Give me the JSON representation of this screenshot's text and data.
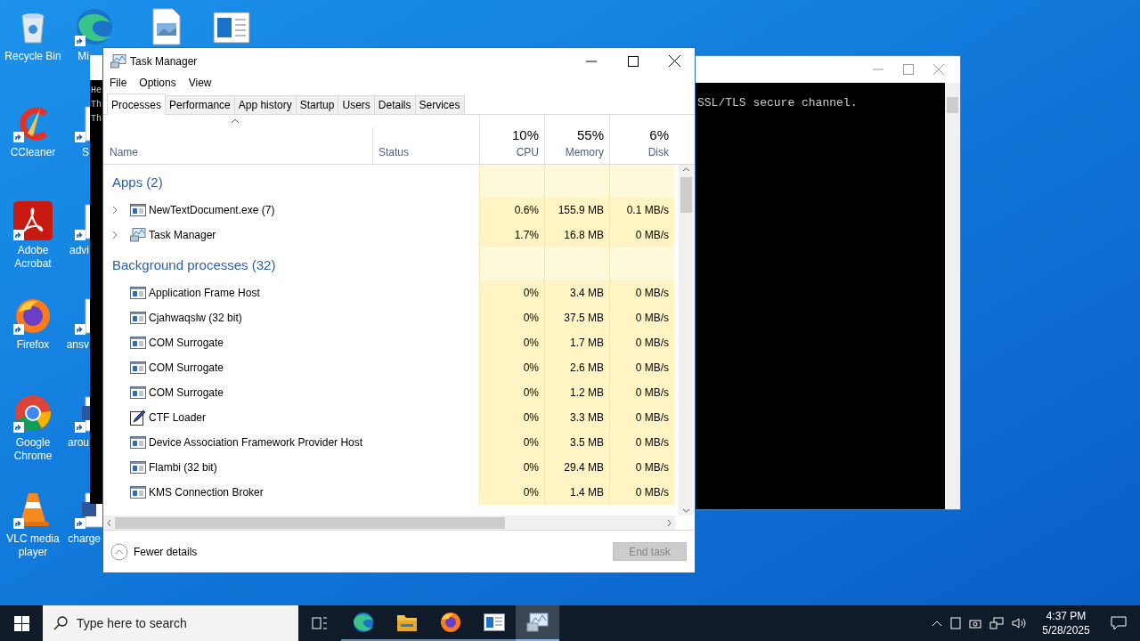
{
  "desktop_icons": [
    {
      "label": "Recycle Bin"
    },
    {
      "label": "CCleaner"
    },
    {
      "label": "Adobe Acrobat"
    },
    {
      "label": "Firefox"
    },
    {
      "label": "Google Chrome"
    },
    {
      "label": "VLC media player"
    }
  ],
  "desktop_icons_2": [
    {
      "label": "Mi"
    },
    {
      "label": "S"
    },
    {
      "label": "advi"
    },
    {
      "label": "ansv"
    },
    {
      "label": "arou"
    },
    {
      "label": "charge"
    }
  ],
  "console_back": {
    "lines": [
      "He",
      "Th",
      "Th"
    ]
  },
  "console_front": {
    "lines": [
      "SSL/TLS secure channel."
    ]
  },
  "task_manager": {
    "title": "Task Manager",
    "menu": [
      "File",
      "Options",
      "View"
    ],
    "tabs": [
      {
        "label": "Processes",
        "selected": true
      },
      {
        "label": "Performance",
        "selected": false
      },
      {
        "label": "App history",
        "selected": false
      },
      {
        "label": "Startup",
        "selected": false
      },
      {
        "label": "Users",
        "selected": false
      },
      {
        "label": "Details",
        "selected": false
      },
      {
        "label": "Services",
        "selected": false
      }
    ],
    "columns": {
      "name": "Name",
      "status": "Status",
      "metrics": [
        {
          "percent": "10%",
          "label": "CPU"
        },
        {
          "percent": "55%",
          "label": "Memory"
        },
        {
          "percent": "6%",
          "label": "Disk"
        }
      ]
    },
    "groups": [
      {
        "title": "Apps (2)",
        "rows": [
          {
            "name": "NewTextDocument.exe (7)",
            "expandable": true,
            "cpu": "0.6%",
            "memory": "155.9 MB",
            "disk": "0.1 MB/s"
          },
          {
            "name": "Task Manager",
            "expandable": true,
            "cpu": "1.7%",
            "memory": "16.8 MB",
            "disk": "0 MB/s"
          }
        ]
      },
      {
        "title": "Background processes (32)",
        "rows": [
          {
            "name": "Application Frame Host",
            "expandable": false,
            "cpu": "0%",
            "memory": "3.4 MB",
            "disk": "0 MB/s"
          },
          {
            "name": "Cjahwaqslw (32 bit)",
            "expandable": false,
            "cpu": "0%",
            "memory": "37.5 MB",
            "disk": "0 MB/s"
          },
          {
            "name": "COM Surrogate",
            "expandable": false,
            "cpu": "0%",
            "memory": "1.7 MB",
            "disk": "0 MB/s"
          },
          {
            "name": "COM Surrogate",
            "expandable": false,
            "cpu": "0%",
            "memory": "2.6 MB",
            "disk": "0 MB/s"
          },
          {
            "name": "COM Surrogate",
            "expandable": false,
            "cpu": "0%",
            "memory": "1.2 MB",
            "disk": "0 MB/s"
          },
          {
            "name": "CTF Loader",
            "expandable": false,
            "cpu": "0%",
            "memory": "3.3 MB",
            "disk": "0 MB/s"
          },
          {
            "name": "Device Association Framework Provider Host",
            "expandable": false,
            "cpu": "0%",
            "memory": "3.5 MB",
            "disk": "0 MB/s"
          },
          {
            "name": "Flambi (32 bit)",
            "expandable": false,
            "cpu": "0%",
            "memory": "29.4 MB",
            "disk": "0 MB/s"
          },
          {
            "name": "KMS Connection Broker",
            "expandable": false,
            "cpu": "0%",
            "memory": "1.4 MB",
            "disk": "0 MB/s"
          }
        ]
      }
    ],
    "footer": {
      "toggle": "Fewer details",
      "end_task": "End task",
      "end_task_disabled": true
    }
  },
  "taskbar": {
    "search_placeholder": "Type here to search",
    "apps": [
      {
        "selected": false
      },
      {
        "selected": false
      },
      {
        "selected": false
      },
      {
        "selected": false
      },
      {
        "selected": true
      }
    ],
    "time": "4:37 PM",
    "date": "5/28/2025"
  }
}
